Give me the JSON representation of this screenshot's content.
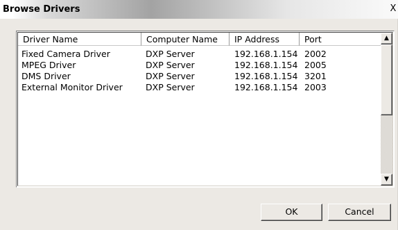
{
  "window": {
    "title": "Browse Drivers",
    "close_glyph": "X"
  },
  "table": {
    "columns": [
      "Driver Name",
      "Computer Name",
      "IP Address",
      "Port"
    ],
    "rows": [
      {
        "driver": "Fixed Camera Driver",
        "computer": "DXP Server",
        "ip": "192.168.1.154",
        "port": "2002"
      },
      {
        "driver": "MPEG Driver",
        "computer": "DXP Server",
        "ip": "192.168.1.154",
        "port": "2005"
      },
      {
        "driver": "DMS Driver",
        "computer": "DXP Server",
        "ip": "192.168.1.154",
        "port": "3201"
      },
      {
        "driver": "External Monitor Driver",
        "computer": "DXP Server",
        "ip": "192.168.1.154",
        "port": "2003"
      }
    ]
  },
  "scrollbar": {
    "up_glyph": "▲",
    "down_glyph": "▼",
    "up_icon": "scroll-up-arrow-icon",
    "down_icon": "scroll-down-arrow-icon"
  },
  "buttons": {
    "ok_label": "OK",
    "cancel_label": "Cancel"
  }
}
